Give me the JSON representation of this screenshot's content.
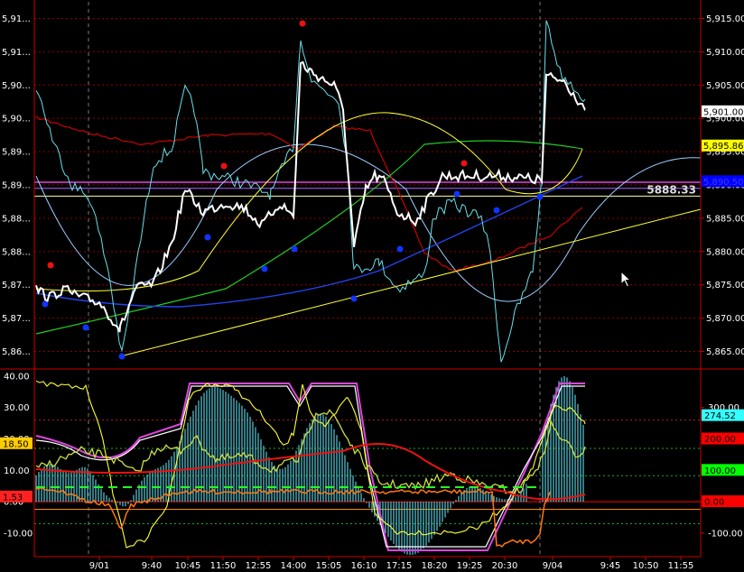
{
  "chart_data": [
    {
      "type": "line",
      "panel": "price",
      "ylim": [
        5862.5,
        5917.5
      ],
      "left_ticks": [
        "5,91...",
        "5,91...",
        "5,90...",
        "5,90...",
        "5,89...",
        "5,89...",
        "5,88...",
        "5,88...",
        "5,87...",
        "5,87...",
        "5,86..."
      ],
      "right_ticks": [
        "5,915.00",
        "5,910.00",
        "5,905.00",
        "5,900.00",
        "5,895.00",
        "5,890.00",
        "5,885.00",
        "5,880.00",
        "5,875.00",
        "5,870.00",
        "5,865.00"
      ],
      "right_tick_values": [
        5915,
        5910,
        5905,
        5900,
        5895,
        5890,
        5885,
        5880,
        5875,
        5870,
        5865
      ],
      "price_labels": [
        {
          "text": "5,901.00",
          "value": 5901.0,
          "bg": "#ffffff",
          "fg": "#000000"
        },
        {
          "text": "5,895.86",
          "value": 5895.86,
          "bg": "#ffff00",
          "fg": "#000000"
        },
        {
          "text": "5,890.50",
          "value": 5890.5,
          "bg": "#0000ff",
          "fg": "#3a3aff"
        }
      ],
      "hline_label": {
        "text": "5888.33",
        "value": 5888.33
      },
      "colors": {
        "price": "#ffffff",
        "cyan": "#66e0e8",
        "red": "#cc0000",
        "green": "#22cc22",
        "blue": "#2244ee",
        "yellow": "#ffff33",
        "sky": "#99ccff",
        "magenta": "#dd44dd"
      }
    },
    {
      "type": "line",
      "panel": "oscillator",
      "ylim": [
        -17.5,
        42
      ],
      "left_ticks": [
        "40.00",
        "30.00",
        "20.00",
        "10.00",
        "0.00",
        "-10.00"
      ],
      "left_tick_values": [
        40,
        30,
        20,
        10,
        0,
        -10
      ],
      "right_ticks": [
        "300.00",
        "200.00",
        "100.00",
        "0.00",
        "-100.00"
      ],
      "right_tick_values": [
        300,
        200,
        100,
        0,
        -100
      ],
      "right_ylim": [
        -175,
        420
      ],
      "left_labels": [
        {
          "text": "18.50",
          "value": 18.5,
          "bg": "#ffcc00",
          "fg": "#000000"
        },
        {
          "text": "1.53",
          "value": 1.53,
          "bg": "#ff2222",
          "fg": "#000000"
        }
      ],
      "right_labels": [
        {
          "text": "274.52",
          "value": 274.52,
          "bg": "#33ffff",
          "fg": "#000000"
        },
        {
          "text": "200.00",
          "value": 200,
          "bg": "#ff0000",
          "fg": "#000000"
        },
        {
          "text": "100.00",
          "value": 100,
          "bg": "#00ff00",
          "fg": "#000000"
        },
        {
          "text": "0.00",
          "value": 0,
          "bg": "#ff0000",
          "fg": "#000000"
        }
      ],
      "x_labels": [
        "9/01",
        "9:40",
        "10:45",
        "11:50",
        "12:55",
        "14:00",
        "15:05",
        "16:10",
        "17:15",
        "18:20",
        "19:25",
        "20:30",
        "9/04",
        "9:45",
        "10:50",
        "11:55"
      ]
    }
  ]
}
